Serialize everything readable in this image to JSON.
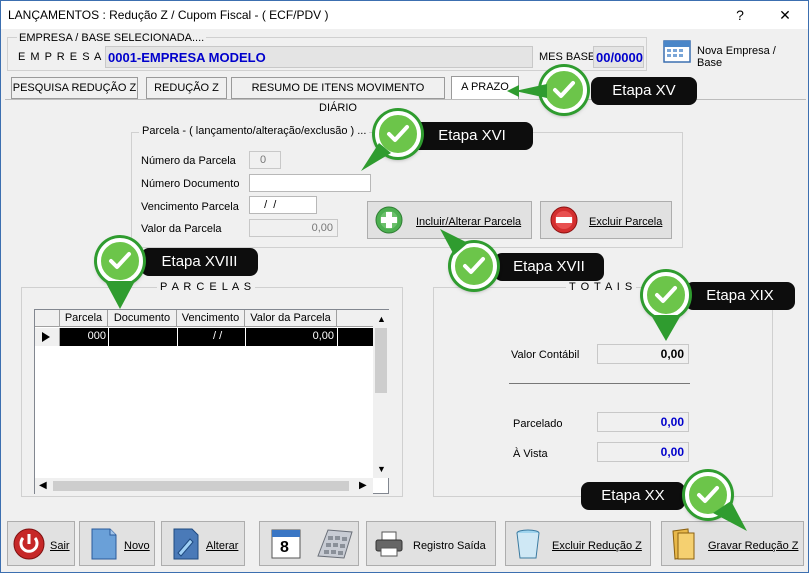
{
  "window": {
    "title": "LANÇAMENTOS : Redução Z / Cupom Fiscal - ( ECF/PDV )",
    "help": "?",
    "close": "✕"
  },
  "empresa": {
    "group_title": "EMPRESA  /  BASE  SELECIONADA....",
    "label": "E M P R E S A",
    "value": "0001-EMPRESA MODELO",
    "mes_base_label": "MES BASE",
    "mes_base_value": "00/0000",
    "nova_empresa_label": "Nova Empresa / Base"
  },
  "tabs": [
    {
      "label": "PESQUISA REDUÇÃO Z"
    },
    {
      "label": "REDUÇÃO Z"
    },
    {
      "label": "RESUMO DE ITENS MOVIMENTO DIÁRIO"
    },
    {
      "label": "A PRAZO"
    }
  ],
  "parcela_form": {
    "group_title": "Parcela - ( lançamento/alteração/exclusão ) ...",
    "numero_parcela_label": "Número da Parcela",
    "numero_parcela_value": "0",
    "numero_documento_label": "Número  Documento",
    "numero_documento_value": "",
    "vencimento_label": "Vencimento Parcela",
    "vencimento_value": "  /  /",
    "valor_label": "Valor da Parcela",
    "valor_value": "0,00",
    "incluir_button": "Incluir/Alterar Parcela",
    "excluir_button": "Excluir Parcela"
  },
  "parcelas": {
    "group_title": "P A R C E L A S",
    "columns": [
      "Parcela",
      "Documento",
      "Vencimento",
      "Valor da Parcela"
    ],
    "rows": [
      {
        "parcela": "000",
        "documento": "",
        "vencimento": " / /",
        "valor": "0,00"
      }
    ]
  },
  "totais": {
    "group_title": "T O T A I S",
    "valor_contabil_label": "Valor Contábil",
    "valor_contabil_value": "0,00",
    "parcelado_label": "Parcelado",
    "parcelado_value": "0,00",
    "a_vista_label": "À Vista",
    "a_vista_value": "0,00"
  },
  "toolbar": {
    "sair": "Sair",
    "novo": "Novo",
    "alterar": "Alterar",
    "calendar_day": "8",
    "registro_saida": "Registro Saída",
    "excluir_reducao": "Excluir Redução Z",
    "gravar_reducao": "Gravar Redução Z"
  },
  "callouts": {
    "xv": "Etapa XV",
    "xvi": "Etapa XVI",
    "xvii": "Etapa XVII",
    "xviii": "Etapa XVIII",
    "xix": "Etapa XIX",
    "xx": "Etapa XX"
  },
  "colors": {
    "accent_blue": "#0000cc",
    "callout_bg": "#0d0d0d",
    "badge_green": "#6cc54a",
    "selection": "#000000"
  }
}
